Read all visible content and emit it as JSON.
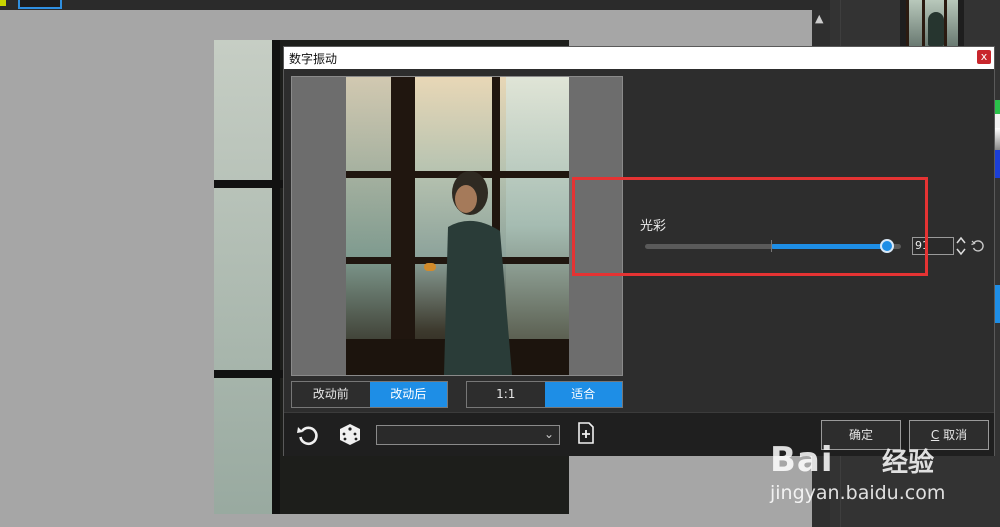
{
  "dialog": {
    "title": "数字振动",
    "close_label": "x",
    "compare_toggle": {
      "before_label": "改动前",
      "after_label": "改动后",
      "active": "after"
    },
    "zoom_toggle": {
      "actual_label": "1:1",
      "fit_label": "适合",
      "active": "fit"
    },
    "preset_select": {
      "value": ""
    },
    "param": {
      "label": "光彩",
      "value_text": "91",
      "level": 91
    },
    "buttons": {
      "ok_label": "确定",
      "cancel_prefix": "C",
      "cancel_label": " 取消"
    }
  },
  "watermark": {
    "logo": "Bai",
    "logo_cn": "经验",
    "url": "jingyan.baidu.com"
  },
  "colors": {
    "accent": "#1e8ee6",
    "highlight": "#e53333",
    "close": "#c8262c"
  },
  "icons": [
    "reset-icon",
    "dice-icon",
    "new-preset-icon",
    "chevron-down-icon",
    "undo-icon",
    "spin-icon",
    "close-icon"
  ]
}
